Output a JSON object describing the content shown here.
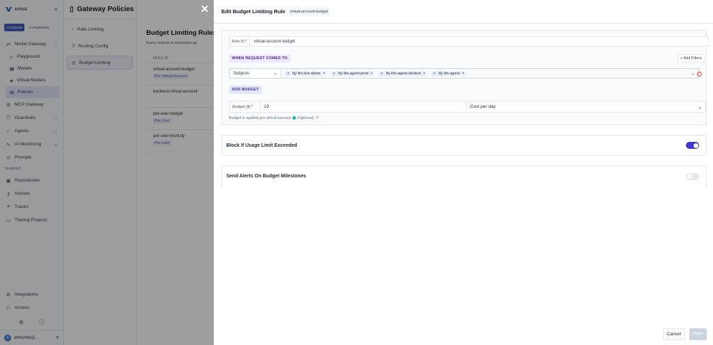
{
  "sidebar": {
    "logo_text": "ATRUE",
    "workspace_tabs": [
      "AI Gateway",
      "AI Engineering"
    ],
    "gateway_section": "Model Gateway",
    "gateway_items": [
      "Playground",
      "Models",
      "Virtual Models",
      "Policies"
    ],
    "items": [
      "MCP Gateway",
      "Guardrails",
      "Agents",
      "AI Monitoring",
      "Prompts"
    ],
    "shared_label": "SHARED",
    "shared_items": [
      "Repositories",
      "Secrets",
      "Traces",
      "Tracing Projects"
    ],
    "bottom_items": [
      "Integrations",
      "Access"
    ],
    "user": "abhishek@..."
  },
  "policy_nav": {
    "title": "Gateway Policies",
    "items": [
      "Rate Limiting",
      "Routing Config",
      "Budget Limiting"
    ]
  },
  "policy_main": {
    "title": "Budget Limiting Rules",
    "description": "Every request is evaluated ag",
    "column": "RULE ID",
    "rows": [
      {
        "id": "virtual-account-budget",
        "tag": "Per Virtual Account"
      },
      {
        "id": "backend-virtual-account",
        "tag": ""
      },
      {
        "id": "per-user-budget",
        "tag": "Per User"
      },
      {
        "id": "per-user-mcnt.tly",
        "tag": "Per User"
      }
    ]
  },
  "drawer": {
    "title": "Edit Budget Limiting Rule",
    "badge": "virtual-account-budget",
    "rule_id_label": "Rule ID",
    "rule_id_value": "virtual-account-budget",
    "when_label": "WHEN REQUEST COMES TO",
    "add_filters": "+ Add Filters",
    "subjects_label": "Subjects",
    "subject_chips": [
      "tfy-llm-live-demo",
      "tfy-llm-agent-prod",
      "tfy-llm-agent-devtest",
      "tfy-llm-agent"
    ],
    "add_budget": "ADD BUDGET",
    "budget_label": "Budget ($)",
    "budget_value": "10",
    "budget_period": "Cost per day",
    "budget_hint": "Budget is applied per virtual account",
    "optional": "(Optional)",
    "block_label": "Block If Usage Limit Exceeded",
    "block_enabled": true,
    "alerts_label": "Send Alerts On Budget Milestones",
    "alerts_enabled": false,
    "cancel": "Cancel",
    "save": "Save"
  }
}
